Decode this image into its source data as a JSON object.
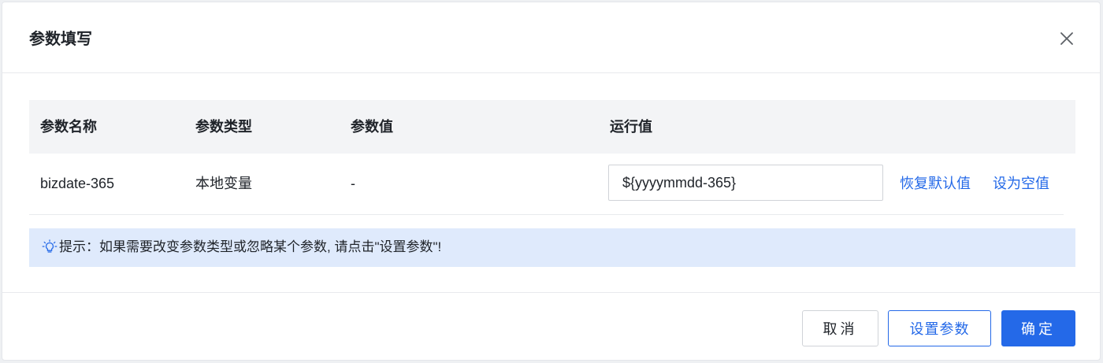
{
  "dialog": {
    "title": "参数填写",
    "close_icon": "close-icon"
  },
  "table": {
    "columns": [
      "参数名称",
      "参数类型",
      "参数值",
      "运行值"
    ],
    "rows": [
      {
        "name": "bizdate-365",
        "type": "本地变量",
        "value": "-",
        "run_value": "${yyyymmdd-365}",
        "actions": [
          "恢复默认值",
          "设为空值"
        ]
      }
    ]
  },
  "tip": {
    "icon": "lightbulb-icon",
    "text": "提示：如果需要改变参数类型或忽略某个参数, 请点击\"设置参数\"!"
  },
  "footer": {
    "cancel_label": "取消",
    "set_params_label": "设置参数",
    "confirm_label": "确定"
  },
  "colors": {
    "primary": "#2469e8",
    "tip_background": "#dfeafc",
    "header_background": "#f3f4f6"
  }
}
